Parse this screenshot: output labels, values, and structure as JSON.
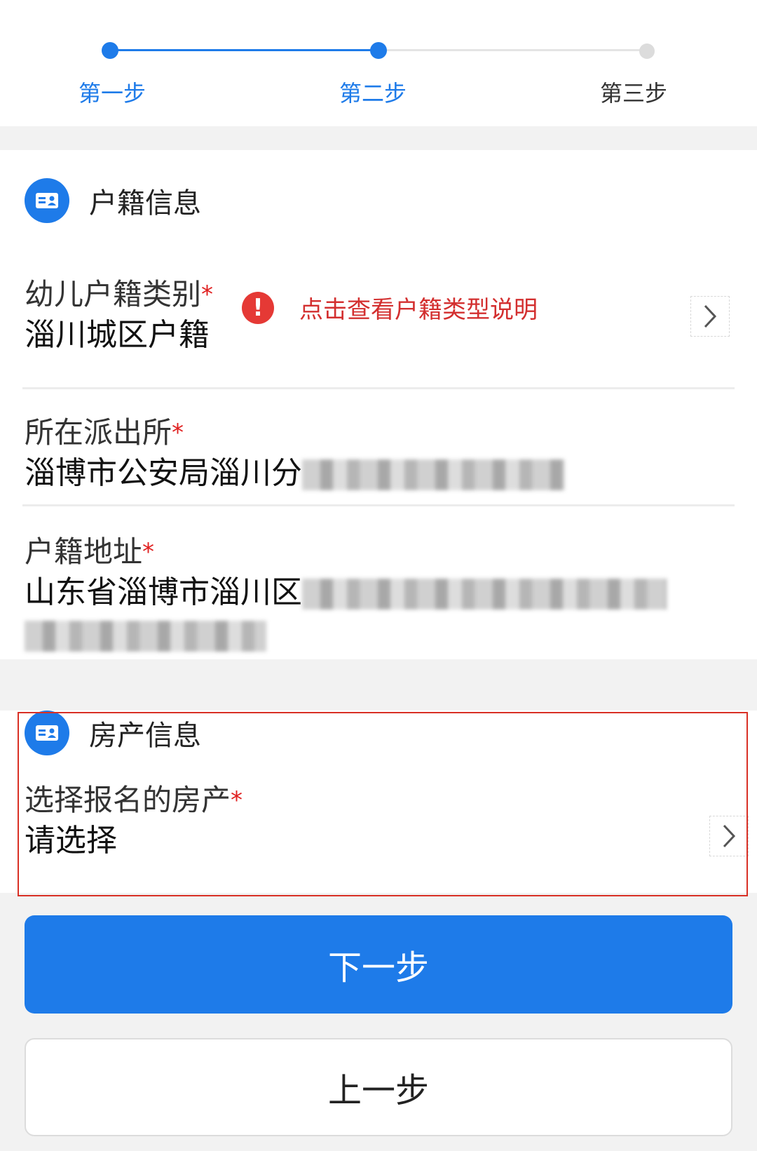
{
  "stepper": {
    "steps": [
      {
        "label": "第一步",
        "state": "done"
      },
      {
        "label": "第二步",
        "state": "current"
      },
      {
        "label": "第三步",
        "state": "pending"
      }
    ]
  },
  "huji": {
    "section_title": "户籍信息",
    "category": {
      "label": "幼儿户籍类别",
      "required_mark": "*",
      "hint": "点击查看户籍类型说明",
      "value": "淄川城区户籍"
    },
    "police_station": {
      "label": "所在派出所",
      "required_mark": "*",
      "value": "淄博市公安局淄川分"
    },
    "address": {
      "label": "户籍地址",
      "required_mark": "*",
      "value": "山东省淄博市淄川区"
    }
  },
  "property": {
    "section_title": "房产信息",
    "field_label": "选择报名的房产",
    "required_mark": "*",
    "value": "请选择"
  },
  "buttons": {
    "next": "下一步",
    "prev": "上一步"
  },
  "colors": {
    "accent": "#1e7be9",
    "required": "#e02020",
    "hint": "#d32f2f",
    "highlight_border": "#d93025"
  }
}
